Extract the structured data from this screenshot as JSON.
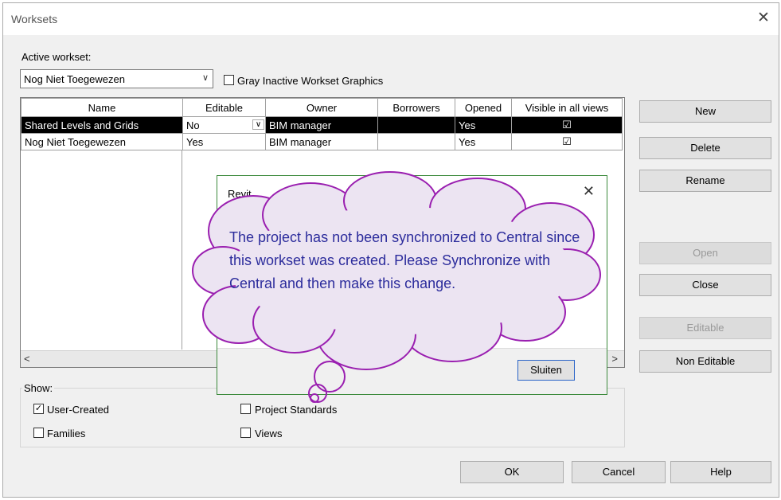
{
  "dialog": {
    "title": "Worksets",
    "active_workset_label": "Active workset:",
    "active_workset_value": "Nog Niet Toegewezen",
    "gray_inactive_label": "Gray Inactive Workset Graphics"
  },
  "table": {
    "headers": [
      "Name",
      "Editable",
      "Owner",
      "Borrowers",
      "Opened",
      "Visible in all views"
    ],
    "rows": [
      {
        "name": "Shared Levels and Grids",
        "editable": "No",
        "owner": "BIM manager",
        "borrowers": "",
        "opened": "Yes",
        "visible": "☑"
      },
      {
        "name": "Nog Niet Toegewezen",
        "editable": "Yes",
        "owner": "BIM manager",
        "borrowers": "",
        "opened": "Yes",
        "visible": "☑"
      }
    ]
  },
  "side_buttons": {
    "new": "New",
    "delete": "Delete",
    "rename": "Rename",
    "open": "Open",
    "close": "Close",
    "editable": "Editable",
    "non_editable": "Non Editable"
  },
  "show": {
    "title": "Show:",
    "user_created": "User-Created",
    "families": "Families",
    "project_standards": "Project Standards",
    "views": "Views"
  },
  "footer": {
    "ok": "OK",
    "cancel": "Cancel",
    "help": "Help"
  },
  "message": {
    "title": "Revit",
    "text": "The project has not been synchronized to Central since this workset was created.  Please Synchronize with Central and then make this change.",
    "button": "Sluiten"
  },
  "colors": {
    "cloud_stroke": "#9a1fb0",
    "cloud_fill": "#ece4f2",
    "message_text": "#2c2c9c"
  }
}
